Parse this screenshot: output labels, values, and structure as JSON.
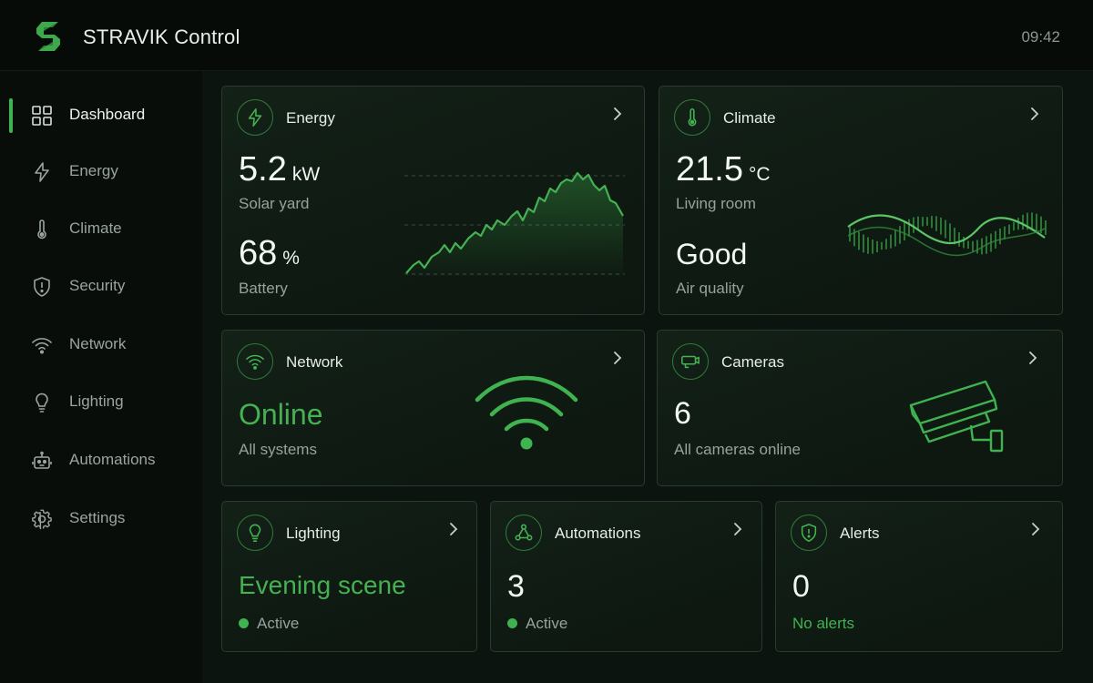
{
  "app": {
    "title": "STRAVIK Control",
    "time": "09:42"
  },
  "sidebar": {
    "items": [
      {
        "label": "Dashboard",
        "icon": "grid-icon",
        "active": true
      },
      {
        "label": "Energy",
        "icon": "bolt-icon"
      },
      {
        "label": "Climate",
        "icon": "thermometer-icon"
      },
      {
        "label": "Security",
        "icon": "shield-icon"
      },
      {
        "label": "Network",
        "icon": "wifi-icon"
      },
      {
        "label": "Lighting",
        "icon": "bulb-icon"
      },
      {
        "label": "Automations",
        "icon": "robot-icon"
      },
      {
        "label": "Settings",
        "icon": "gear-icon"
      }
    ]
  },
  "cards": {
    "energy": {
      "title": "Energy",
      "icon": "bolt-icon",
      "solar_value": "5.2",
      "solar_unit": "kW",
      "solar_label": "Solar yard",
      "battery_value": "68",
      "battery_unit": "%",
      "battery_label": "Battery"
    },
    "climate": {
      "title": "Climate",
      "icon": "thermometer-icon",
      "temp_value": "21.5",
      "temp_unit": "°C",
      "temp_label": "Living room",
      "air_value": "Good",
      "air_label": "Air quality"
    },
    "network": {
      "title": "Network",
      "icon": "wifi-icon",
      "status": "Online",
      "label": "All systems"
    },
    "cameras": {
      "title": "Cameras",
      "icon": "camera-icon",
      "value": "6",
      "label": "All cameras online"
    },
    "lighting": {
      "title": "Lighting",
      "icon": "bulb-icon",
      "scene": "Evening scene",
      "status": "Active"
    },
    "automations": {
      "title": "Automations",
      "icon": "nodes-icon",
      "value": "3",
      "status": "Active"
    },
    "alerts": {
      "title": "Alerts",
      "icon": "shield-alert-icon",
      "value": "0",
      "label": "No alerts"
    }
  },
  "colors": {
    "accent": "#3fb34f",
    "background": "#0a100c",
    "card_border": "#2b3a2f"
  }
}
